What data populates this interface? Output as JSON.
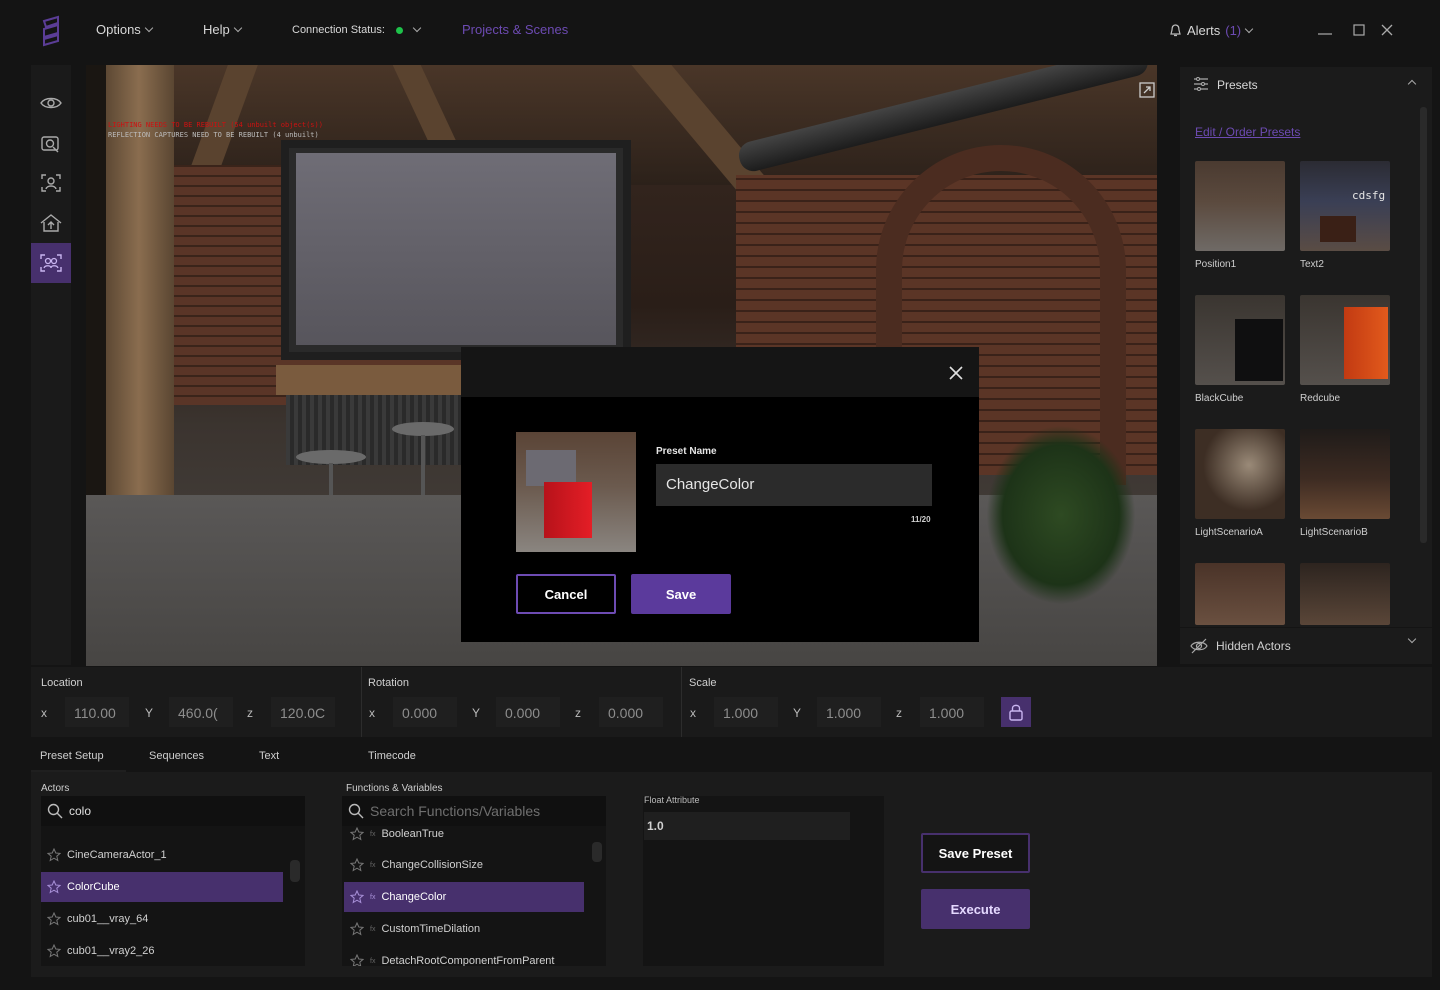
{
  "topbar": {
    "menus": [
      "Options",
      "Help"
    ],
    "connection_label": "Connection Status:",
    "connection_color": "#1ec24a",
    "projects_link": "Projects & Scenes",
    "alerts_label": "Alerts",
    "alerts_count": "(1)",
    "accent": "#6d4bb3"
  },
  "viewport": {
    "warning_line1": "LIGHTING NEEDS TO BE REBUILT (54 unbuilt object(s))",
    "warning_line2": "REFLECTION CAPTURES NEED TO BE REBUILT (4 unbuilt)"
  },
  "presets_panel": {
    "title": "Presets",
    "edit_link": "Edit / Order Presets",
    "items": [
      {
        "label": "Position1"
      },
      {
        "label": "Text2",
        "overlay_text": "cdsfg"
      },
      {
        "label": "BlackCube"
      },
      {
        "label": "Redcube"
      },
      {
        "label": "LightScenarioA"
      },
      {
        "label": "LightScenarioB"
      }
    ],
    "hidden_actors_label": "Hidden Actors"
  },
  "transform": {
    "location": {
      "label": "Location",
      "x": "110.00",
      "y": "460.0(",
      "z": "120.0C"
    },
    "rotation": {
      "label": "Rotation",
      "x": "0.000",
      "y": "0.000",
      "z": "0.000"
    },
    "scale": {
      "label": "Scale",
      "x": "1.000",
      "y": "1.000",
      "z": "1.000"
    },
    "axes": {
      "x": "x",
      "y": "Y",
      "z": "z"
    }
  },
  "tabs": [
    "Preset Setup",
    "Sequences",
    "Text",
    "Timecode"
  ],
  "actors": {
    "label": "Actors",
    "search_value": "colo",
    "items": [
      "CineCameraActor_1",
      "ColorCube",
      "cub01__vray_64",
      "cub01__vray2_26"
    ],
    "selected_index": 1
  },
  "functions": {
    "label": "Functions & Variables",
    "search_placeholder": "Search Functions/Variables",
    "items": [
      "BooleanTrue",
      "ChangeCollisionSize",
      "ChangeColor",
      "CustomTimeDilation",
      "DetachRootComponentFromParent"
    ],
    "selected_index": 2
  },
  "float_attr": {
    "label": "Float Attribute",
    "value": "1.0"
  },
  "actions": {
    "save_preset": "Save Preset",
    "execute": "Execute"
  },
  "modal": {
    "preset_name_label": "Preset Name",
    "preset_name_value": "ChangeColor",
    "char_count": "11/20",
    "cancel": "Cancel",
    "save": "Save"
  }
}
